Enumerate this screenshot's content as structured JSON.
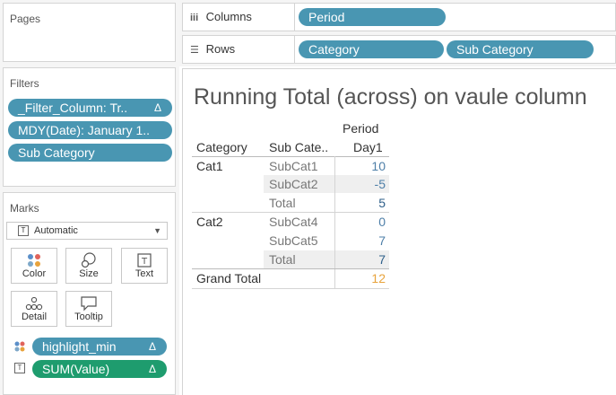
{
  "pages": {
    "title": "Pages"
  },
  "filters": {
    "title": "Filters",
    "items": [
      {
        "label": "_Filter_Column: Tr..",
        "delta": "Δ"
      },
      {
        "label": "MDY(Date): January 1..",
        "delta": ""
      },
      {
        "label": "Sub Category",
        "delta": ""
      }
    ]
  },
  "marks": {
    "title": "Marks",
    "type": "Automatic",
    "buttons": {
      "color": "Color",
      "size": "Size",
      "text": "Text",
      "detail": "Detail",
      "tooltip": "Tooltip"
    },
    "fields": [
      {
        "label": "highlight_min",
        "delta": "Δ"
      },
      {
        "label": "SUM(Value)",
        "delta": "Δ"
      }
    ]
  },
  "shelves": {
    "columns": {
      "label": "Columns",
      "pills": [
        "Period"
      ]
    },
    "rows": {
      "label": "Rows",
      "pills": [
        "Category",
        "Sub Category"
      ]
    }
  },
  "viz": {
    "title": "Running Total (across) on vaule column",
    "header": {
      "period": "Period",
      "category": "Category",
      "subcategory": "Sub Cate..",
      "day": "Day1"
    },
    "rows": [
      {
        "category": "Cat1",
        "sub": "SubCat1",
        "value": "10"
      },
      {
        "category": "",
        "sub": "SubCat2",
        "value": "-5"
      },
      {
        "category": "",
        "sub": "Total",
        "value": "5"
      },
      {
        "category": "Cat2",
        "sub": "SubCat4",
        "value": "0"
      },
      {
        "category": "",
        "sub": "SubCat5",
        "value": "7"
      },
      {
        "category": "",
        "sub": "Total",
        "value": "7"
      }
    ],
    "grand_total": {
      "label": "Grand Total",
      "value": "12"
    },
    "colors": {
      "value": "#4e7fa8",
      "total": "#2e5f8a",
      "grand": "#e8a33c",
      "band": "#efefef"
    }
  }
}
